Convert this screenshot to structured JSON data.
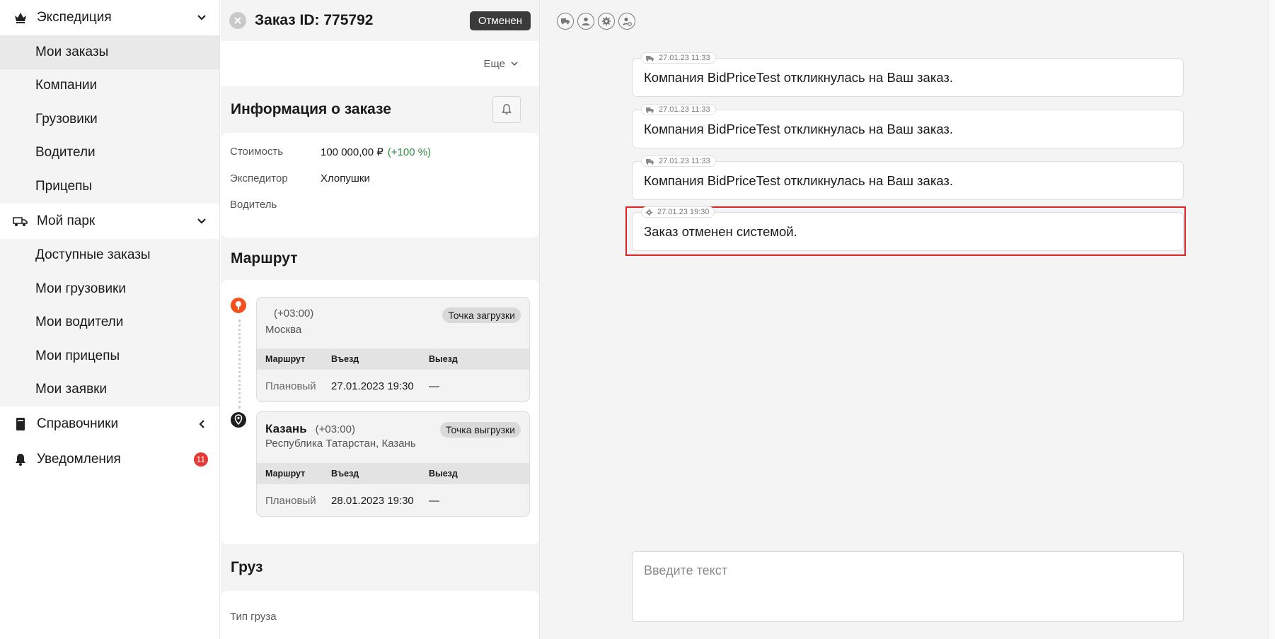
{
  "sidebar": {
    "groups": [
      {
        "label": "Экспедиция",
        "icon": "crown-icon",
        "items": [
          "Мои заказы",
          "Компании",
          "Грузовики",
          "Водители",
          "Прицепы"
        ]
      },
      {
        "label": "Мой парк",
        "icon": "truck-fleet-icon",
        "items": [
          "Доступные заказы",
          "Мои грузовики",
          "Мои водители",
          "Мои прицепы",
          "Мои заявки"
        ]
      },
      {
        "label": "Справочники",
        "icon": "book-icon"
      },
      {
        "label": "Уведомления",
        "icon": "bell-icon",
        "badge": "11"
      }
    ],
    "active_item": "Мои заказы"
  },
  "order": {
    "title": "Заказ ID: 775792",
    "status": "Отменен",
    "more_label": "Еще",
    "info_title": "Информация о заказе",
    "info": {
      "cost_label": "Стоимость",
      "cost_value": "100 000,00 ₽",
      "cost_pct": "(+100 %)",
      "forwarder_label": "Экспедитор",
      "forwarder_value": "Хлопушки",
      "driver_label": "Водитель"
    },
    "route_title": "Маршрут",
    "stops": [
      {
        "city": "",
        "tz": "(+03:00)",
        "address": "Москва",
        "type": "Точка загрузки",
        "headers": [
          "Маршрут",
          "Въезд",
          "Выезд"
        ],
        "row": [
          "Плановый",
          "27.01.2023 19:30",
          "—"
        ]
      },
      {
        "city": "Казань",
        "tz": "(+03:00)",
        "address": "Республика Татарстан, Казань",
        "type": "Точка выгрузки",
        "headers": [
          "Маршрут",
          "Въезд",
          "Выезд"
        ],
        "row": [
          "Плановый",
          "28.01.2023 19:30",
          "—"
        ]
      }
    ],
    "cargo_title": "Груз",
    "cargo": {
      "type_label": "Тип груза"
    }
  },
  "chat": {
    "tool_icons": [
      "truck-icon",
      "user-icon",
      "gear-icon",
      "user-gear-icon"
    ],
    "messages": [
      {
        "icon": "truck-icon",
        "time": "27.01.23 11:33",
        "text": "Компания BidPriceTest откликнулась на Ваш заказ."
      },
      {
        "icon": "truck-icon",
        "time": "27.01.23 11:33",
        "text": "Компания BidPriceTest откликнулась на Ваш заказ."
      },
      {
        "icon": "truck-icon",
        "time": "27.01.23 11:33",
        "text": "Компания BidPriceTest откликнулась на Ваш заказ."
      },
      {
        "icon": "gear-icon",
        "time": "27.01.23 19:30",
        "text": "Заказ отменен системой."
      }
    ],
    "input_placeholder": "Введите текст"
  },
  "colors": {
    "highlight": "#d92525",
    "badge": "#e53935",
    "status_bg": "#3b3b3b",
    "pin_origin": "#f4511e",
    "pct": "#2e8b3e"
  }
}
